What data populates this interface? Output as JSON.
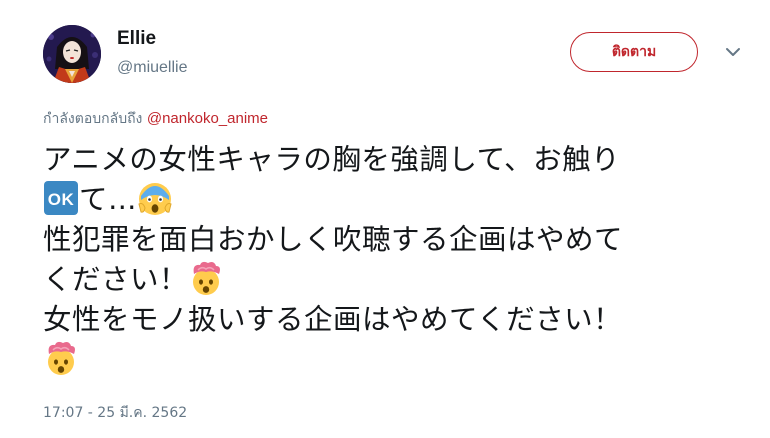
{
  "author": {
    "display_name": "Ellie",
    "handle": "@miuellie"
  },
  "follow_button": {
    "label": "ติดตาม"
  },
  "reply_context": {
    "prefix": "กำลังตอบกลับถึง",
    "mention": "@nankoko_anime"
  },
  "tweet": {
    "line_1": "アニメの女性キャラの胸を強調して、お触り",
    "line_2": "て…",
    "line_3": "性犯罪を面白おかしく吹聴する企画はやめて",
    "line_4": "ください！",
    "line_5": "女性をモノ扱いする企画はやめてください！",
    "emoji": {
      "ok": "ok-button-emoji",
      "scream": "face-screaming-in-fear-emoji",
      "exploding": "exploding-head-emoji"
    }
  },
  "timestamp": "17:07 - 25 มี.ค. 2562",
  "colors": {
    "accent": "#c0262d",
    "muted": "#657786",
    "text": "#14171a",
    "ok_blue": "#3b88c3",
    "emoji_yellow": "#ffcc4d"
  }
}
